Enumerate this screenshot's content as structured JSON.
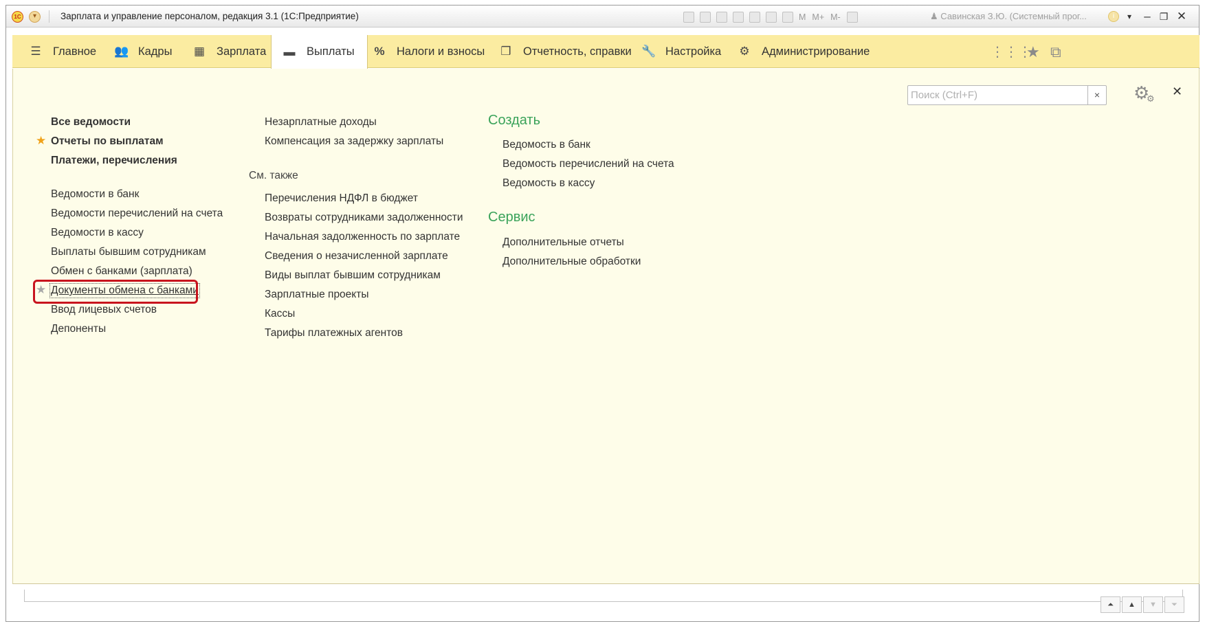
{
  "window": {
    "title": "Зарплата и управление персоналом, редакция 3.1  (1С:Предприятие)",
    "logo_text": "1С",
    "toolbar_texts": [
      "M",
      "M+",
      "M-"
    ],
    "user": "Савинская З.Ю. (Системный прог..."
  },
  "sections": [
    {
      "label": "Главное",
      "icon": "hamburger-icon"
    },
    {
      "label": "Кадры",
      "icon": "people-icon"
    },
    {
      "label": "Зарплата",
      "icon": "calculator-icon"
    },
    {
      "label": "Выплаты",
      "icon": "wallet-icon",
      "active": true
    },
    {
      "label": "Налоги и взносы",
      "icon": "percent-icon"
    },
    {
      "label": "Отчетность, справки",
      "icon": "reports-icon"
    },
    {
      "label": "Настройка",
      "icon": "wrench-icon"
    },
    {
      "label": "Администрирование",
      "icon": "gear-icon"
    }
  ],
  "search": {
    "placeholder": "Поиск (Ctrl+F)",
    "value": ""
  },
  "col1": {
    "main_links": [
      "Все ведомости",
      "Отчеты по выплатам",
      "Платежи, перечисления"
    ],
    "links": [
      "Ведомости в банк",
      "Ведомости перечислений на счета",
      "Ведомости в кассу",
      "Выплаты бывшим сотрудникам",
      "Обмен с банками (зарплата)",
      "Документы обмена с банками",
      "Ввод лицевых счетов",
      "Депоненты"
    ]
  },
  "col2": {
    "links": [
      "Незарплатные доходы",
      "Компенсация за задержку зарплаты"
    ],
    "see_also_header": "См. также",
    "see_also": [
      "Перечисления НДФЛ в бюджет",
      "Возвраты сотрудниками задолженности",
      "Начальная задолженность по зарплате",
      "Сведения о незачисленной зарплате",
      "Виды выплат бывшим сотрудникам",
      "Зарплатные проекты",
      "Кассы",
      "Тарифы платежных агентов"
    ]
  },
  "col3": {
    "create_header": "Создать",
    "create": [
      "Ведомость в банк",
      "Ведомость перечислений на счета",
      "Ведомость в кассу"
    ],
    "service_header": "Сервис",
    "service": [
      "Дополнительные отчеты",
      "Дополнительные обработки"
    ]
  },
  "accent_colors": {
    "section_bar": "#fbeca1",
    "content_bg": "#fefde9",
    "group_header": "#3aa35a",
    "highlight": "#c8141e",
    "favorite_star": "#f0a21a"
  }
}
